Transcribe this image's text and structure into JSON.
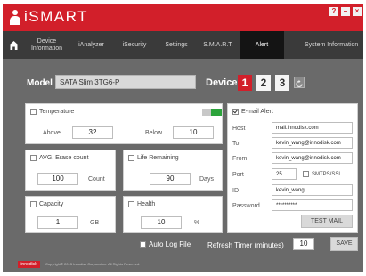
{
  "app": {
    "name": "iSMART"
  },
  "window": {
    "buttons": [
      "?",
      "–",
      "×"
    ]
  },
  "nav": {
    "items": [
      {
        "label": "Device Information"
      },
      {
        "label": "iAnalyzer"
      },
      {
        "label": "iSecurity"
      },
      {
        "label": "Settings"
      },
      {
        "label": "S.M.A.R.T."
      },
      {
        "label": "Alert",
        "active": true
      },
      {
        "label": "System Information"
      }
    ]
  },
  "model": {
    "label": "Model",
    "value": "SATA Slim 3TG6-P"
  },
  "device": {
    "label": "Device",
    "buttons": [
      "1",
      "2",
      "3"
    ],
    "selected": "1"
  },
  "temperature": {
    "label": "Temperature",
    "checked": false,
    "above_label": "Above",
    "above_value": "32",
    "below_label": "Below",
    "below_value": "10"
  },
  "erase": {
    "label": "AVG. Erase count",
    "checked": false,
    "value": "100",
    "unit": "Count"
  },
  "life": {
    "label": "Life Remaining",
    "checked": false,
    "value": "90",
    "unit": "Days"
  },
  "capacity": {
    "label": "Capacity",
    "checked": false,
    "value": "1",
    "unit": "GB"
  },
  "health": {
    "label": "Health",
    "checked": false,
    "value": "10",
    "unit": "%"
  },
  "email": {
    "label": "E-mail Alert",
    "checked": true,
    "host_label": "Host",
    "host": "mail.innodisk.com",
    "to_label": "To",
    "to": "kevin_wang@innodisk.com",
    "from_label": "From",
    "from": "kevin_wang@innodisk.com",
    "port_label": "Port",
    "port": "25",
    "smtps_label": "SMTPS/SSL",
    "id_label": "ID",
    "id": "kevin_wang",
    "password_label": "Password",
    "password": "**********",
    "test_label": "TEST MAIL"
  },
  "bottom": {
    "autolog_label": "Auto Log File",
    "refresh_label": "Refresh Timer (minutes)",
    "refresh_value": "10",
    "save_label": "SAVE"
  },
  "footer": {
    "logo": "innodisk",
    "copyright": "Copyright© 2015 Innodisk Corporation. All Rights Reserved."
  },
  "colors": {
    "accent": "#d21f2a",
    "nav_bg": "#3a3a3a",
    "body_bg": "#6a6a6a",
    "toggle_on": "#2ca33b"
  }
}
